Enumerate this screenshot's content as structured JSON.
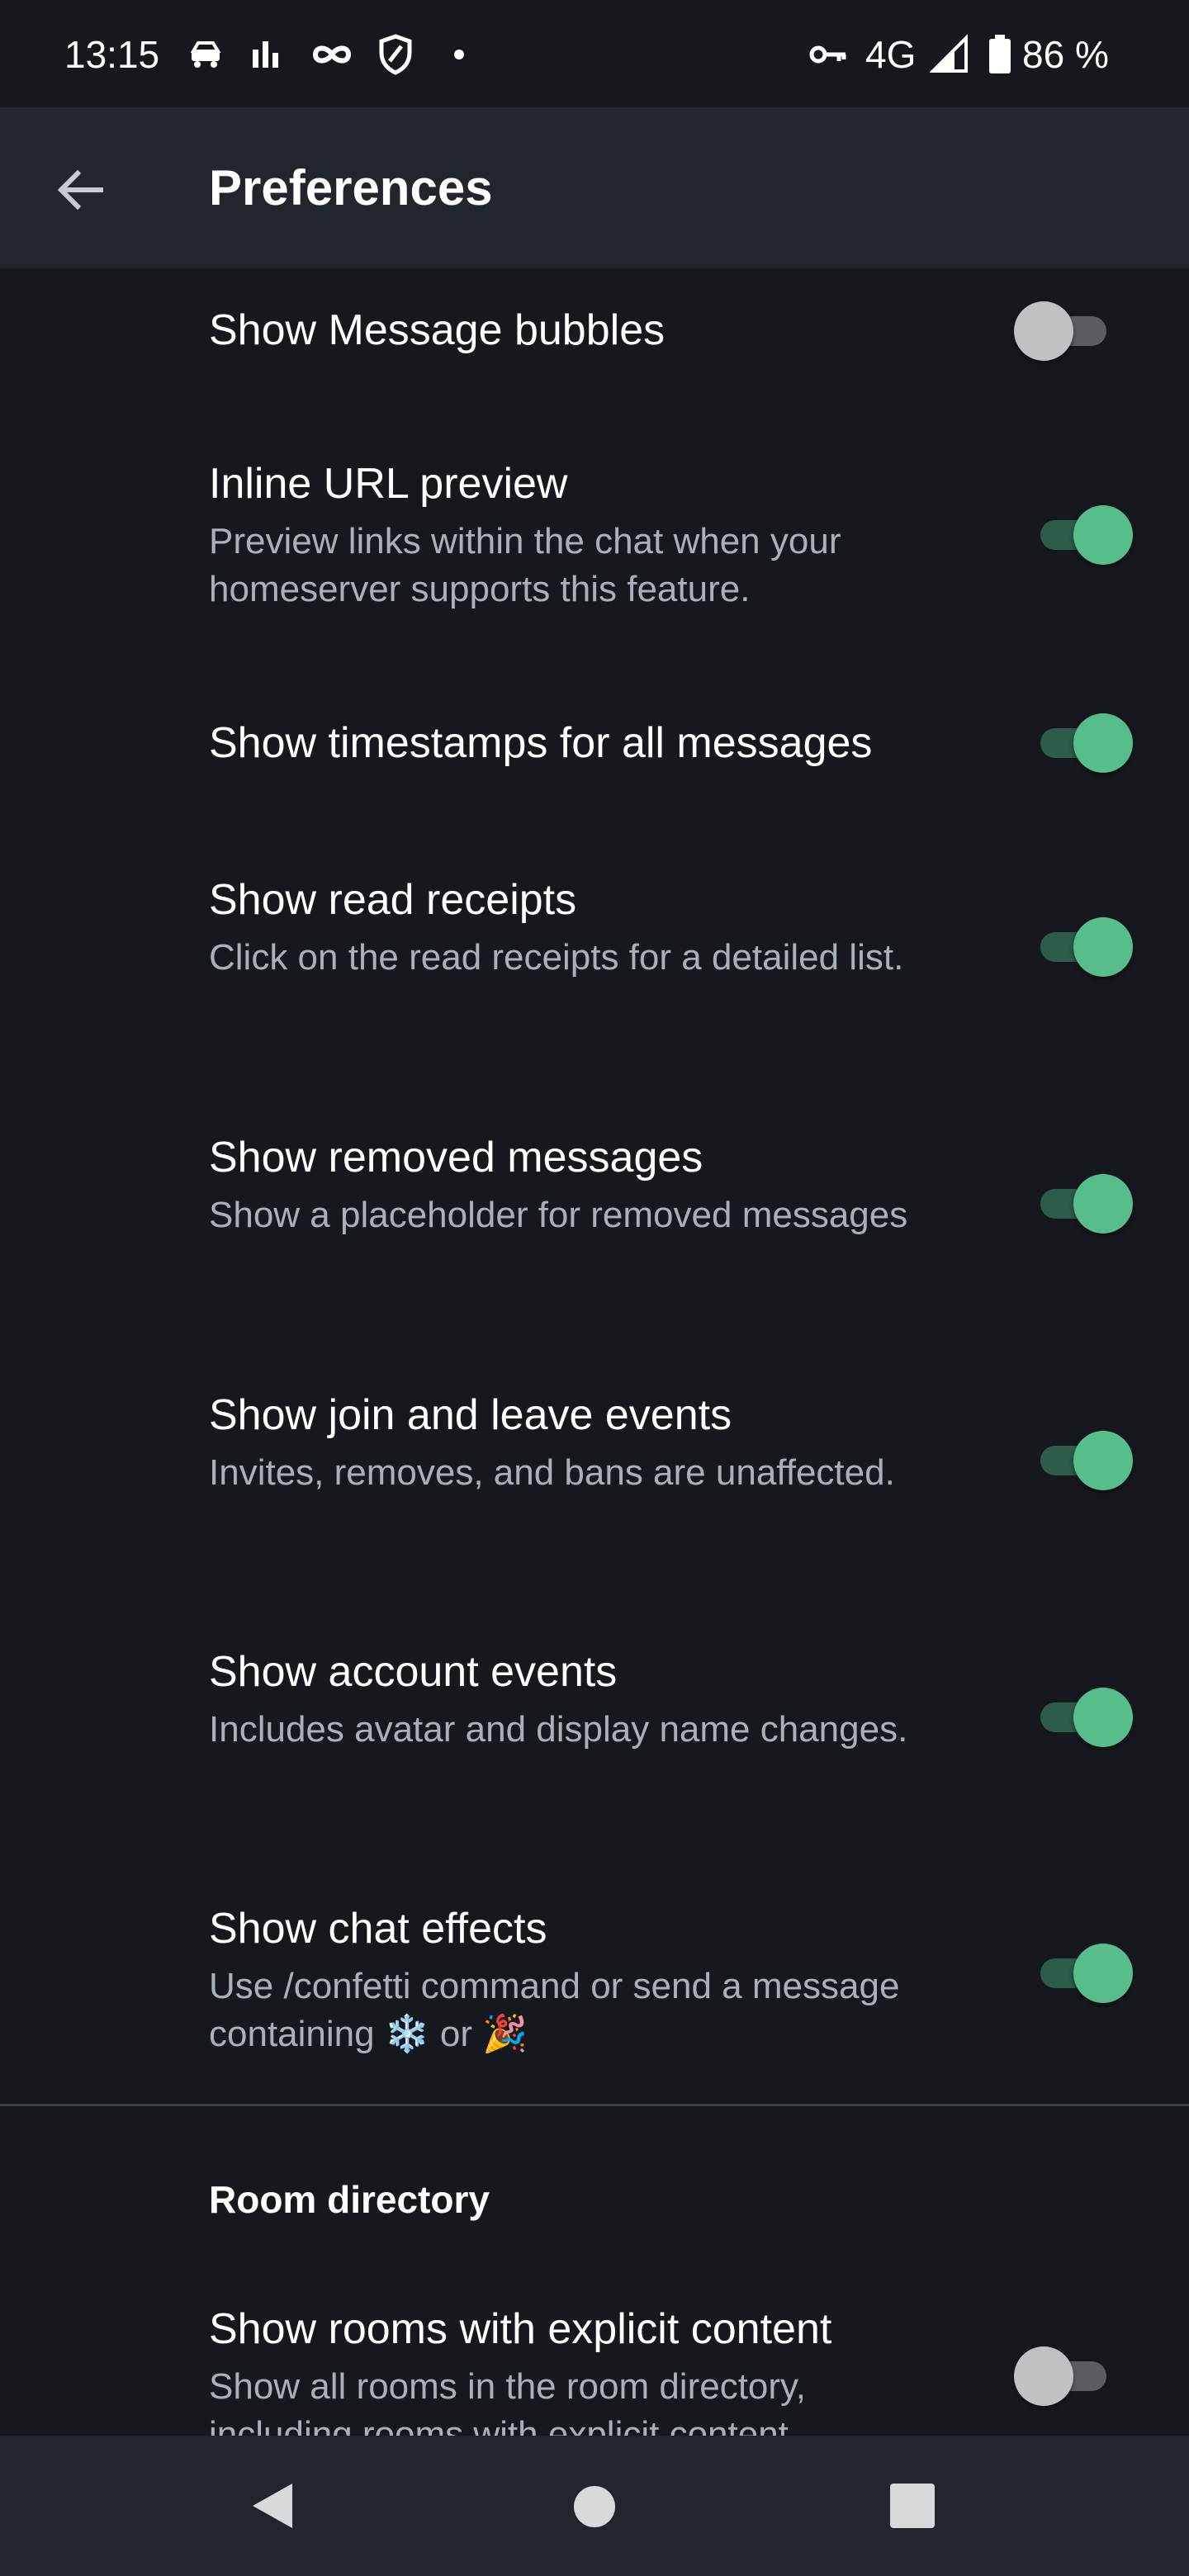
{
  "status_bar": {
    "time": "13:15",
    "network": "4G",
    "battery": "86 %",
    "icons": [
      "driving-mode-icon",
      "bar-chart-icon",
      "infinity-icon",
      "shield-icon",
      "dot-icon",
      "vpn-key-icon",
      "signal-icon",
      "battery-icon"
    ]
  },
  "app_bar": {
    "title": "Preferences",
    "back_icon": "arrow-back-icon"
  },
  "preferences": [
    {
      "title": "Show Message bubbles",
      "subtitle": "",
      "enabled": false
    },
    {
      "title": "Inline URL preview",
      "subtitle": "Preview links within the chat when your homeserver supports this feature.",
      "enabled": true
    },
    {
      "title": "Show timestamps for all messages",
      "subtitle": "",
      "enabled": true
    },
    {
      "title": "Show read receipts",
      "subtitle": "Click on the read receipts for a detailed list.",
      "enabled": true
    },
    {
      "title": "Show removed messages",
      "subtitle": "Show a placeholder for removed messages",
      "enabled": true
    },
    {
      "title": "Show join and leave events",
      "subtitle": "Invites, removes, and bans are unaffected.",
      "enabled": true
    },
    {
      "title": "Show account events",
      "subtitle": "Includes avatar and display name changes.",
      "enabled": true
    },
    {
      "title": "Show chat effects",
      "subtitle_prefix": "Use /confetti command or send a message containing ",
      "emoji_snow": "❄️",
      "subtitle_or": " or ",
      "emoji_party": "🎉",
      "enabled": true
    }
  ],
  "room_directory": {
    "header": "Room directory",
    "item": {
      "title": "Show rooms with explicit content",
      "subtitle": "Show all rooms in the room directory, including rooms with explicit content.",
      "enabled": false
    }
  },
  "nav_bar": {
    "icons": [
      "nav-back-icon",
      "nav-home-icon",
      "nav-recents-icon"
    ]
  },
  "colors": {
    "background": "#15191e",
    "app_bar": "#21262c",
    "accent": "#58bd8c",
    "secondary_text": "#a9b0b8"
  }
}
